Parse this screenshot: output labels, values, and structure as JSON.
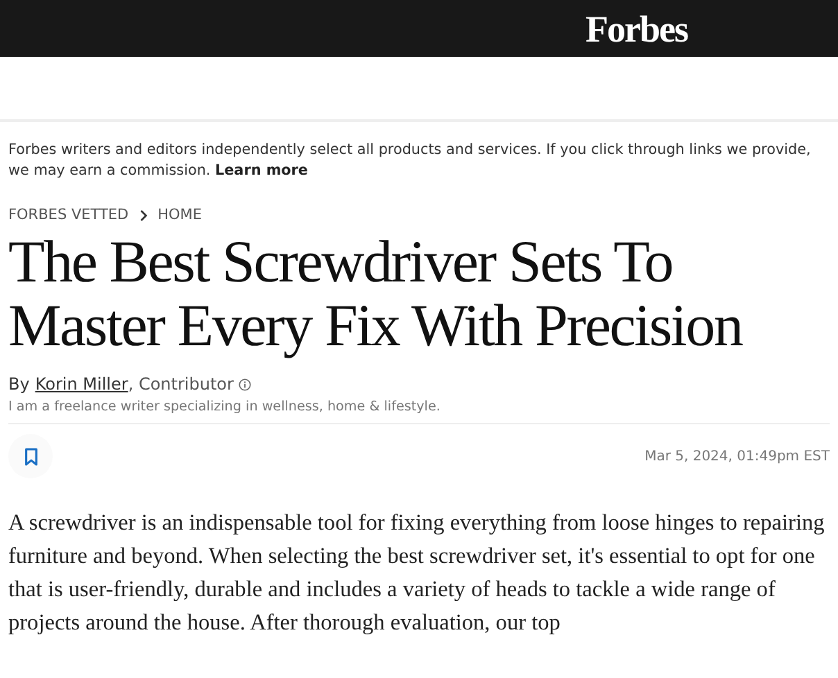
{
  "header": {
    "logo": "Forbes"
  },
  "disclosure": {
    "text": "Forbes writers and editors independently select all products and services. If you click through links we provide, we may earn a commission.",
    "link": "Learn more"
  },
  "breadcrumbs": [
    "FORBES VETTED",
    "HOME"
  ],
  "headline": "The Best Screwdriver Sets To Master Every Fix With Precision",
  "byline": {
    "prefix": "By",
    "author": "Korin Miller",
    "role": ", Contributor",
    "bio": "I am a freelance writer specializing in wellness, home & lifestyle."
  },
  "date": "Mar 5, 2024, 01:49pm EST",
  "body": "A screwdriver is an indispensable tool for fixing everything from loose hinges to repairing furniture and beyond. When selecting the best screwdriver set, it's essential to opt for one that is user-friendly, durable and includes a variety of heads to tackle a wide range of projects around the house. After thorough evaluation, our top"
}
